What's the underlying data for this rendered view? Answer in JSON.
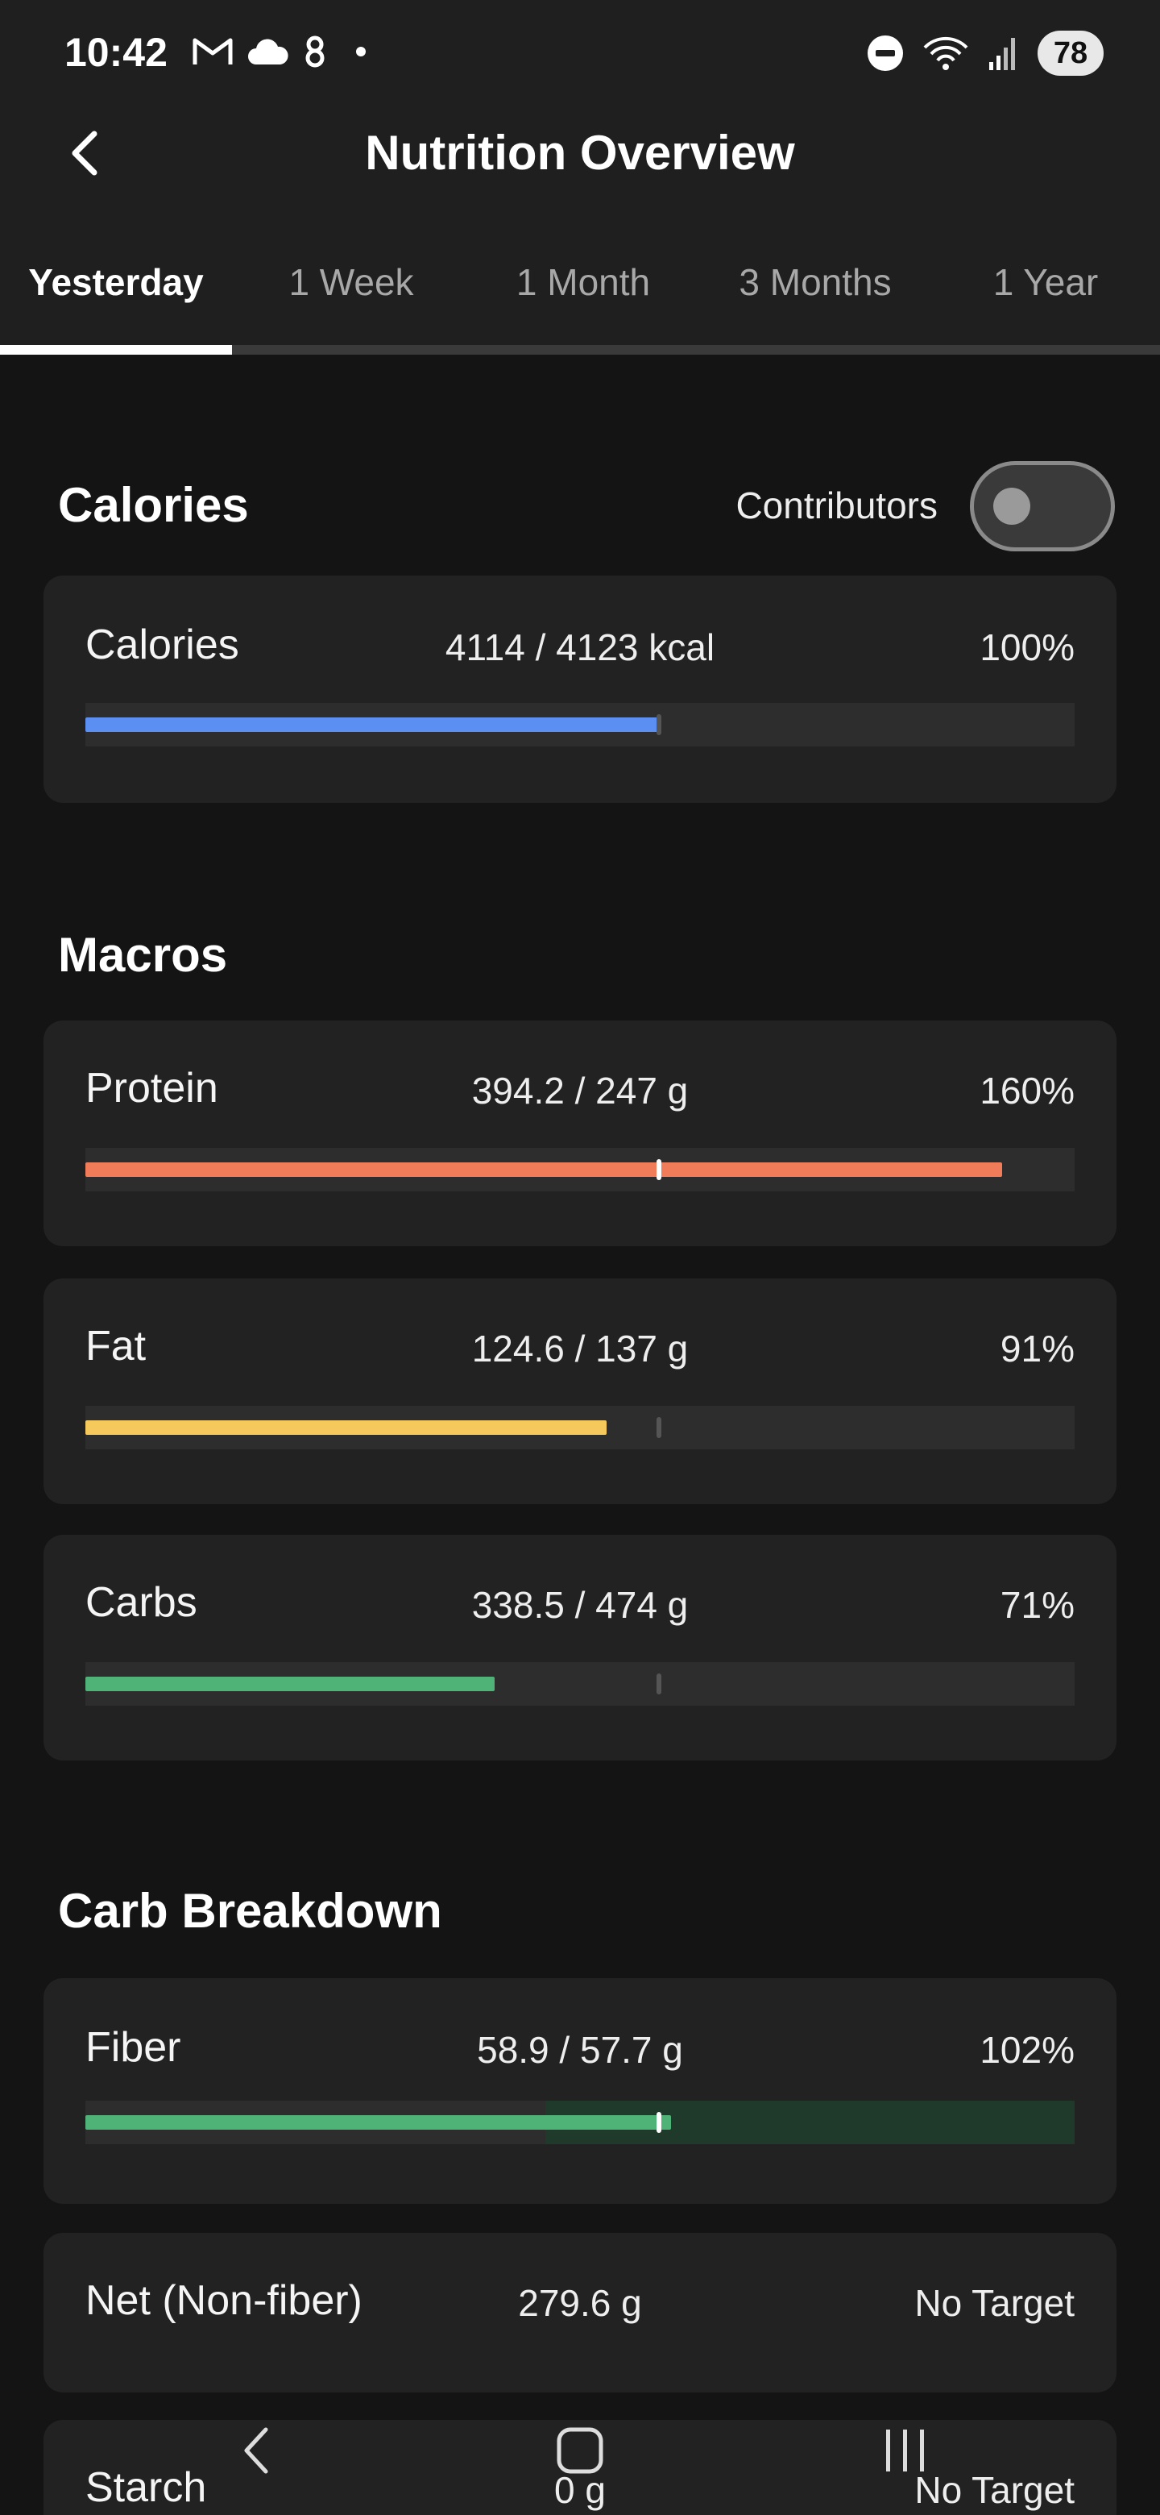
{
  "status_bar": {
    "time": "10:42",
    "left_icons": [
      "gmail-icon",
      "cloud-icon",
      "app-icon",
      "dot-icon"
    ],
    "right_icons": [
      "dnd-icon",
      "wifi-icon",
      "signal-icon"
    ],
    "battery": "78"
  },
  "header": {
    "title": "Nutrition Overview",
    "back_icon": "back-arrow-icon"
  },
  "tabs": [
    {
      "label": "Yesterday",
      "active": true
    },
    {
      "label": "1 Week",
      "active": false
    },
    {
      "label": "1 Month",
      "active": false
    },
    {
      "label": "3 Months",
      "active": false
    },
    {
      "label": "1 Year",
      "active": false
    }
  ],
  "calories_section": {
    "title": "Calories",
    "contributors_label": "Contributors",
    "contributors_on": false,
    "card": {
      "label": "Calories",
      "amount": "4114 / 4123 kcal",
      "percent": "100%",
      "fill": 0.58,
      "target": 0.58,
      "color": "#5b8ff2"
    }
  },
  "macros_section": {
    "title": "Macros",
    "cards": [
      {
        "label": "Protein",
        "amount": "394.2 / 247 g",
        "percent": "160%",
        "fill": 0.927,
        "target": 0.58,
        "color": "#f07c59"
      },
      {
        "label": "Fat",
        "amount": "124.6 / 137 g",
        "percent": "91%",
        "fill": 0.527,
        "target": 0.58,
        "color": "#f5c95b"
      },
      {
        "label": "Carbs",
        "amount": "338.5 / 474 g",
        "percent": "71%",
        "fill": 0.414,
        "target": 0.58,
        "color": "#4fb378"
      }
    ]
  },
  "carb_breakdown_section": {
    "title": "Carb Breakdown",
    "fiber": {
      "label": "Fiber",
      "amount": "58.9 / 57.7 g",
      "percent": "102%",
      "fill": 0.592,
      "target": 0.58,
      "range_start": 0.465,
      "color": "#4fb378"
    },
    "net": {
      "label": "Net (Non-fiber)",
      "amount": "279.6 g",
      "percent": "No Target"
    },
    "starch": {
      "label": "Starch",
      "amount": "0 g",
      "percent": "No Target"
    }
  },
  "nav_bar": [
    "nav-back-icon",
    "nav-home-icon",
    "nav-recents-icon"
  ]
}
